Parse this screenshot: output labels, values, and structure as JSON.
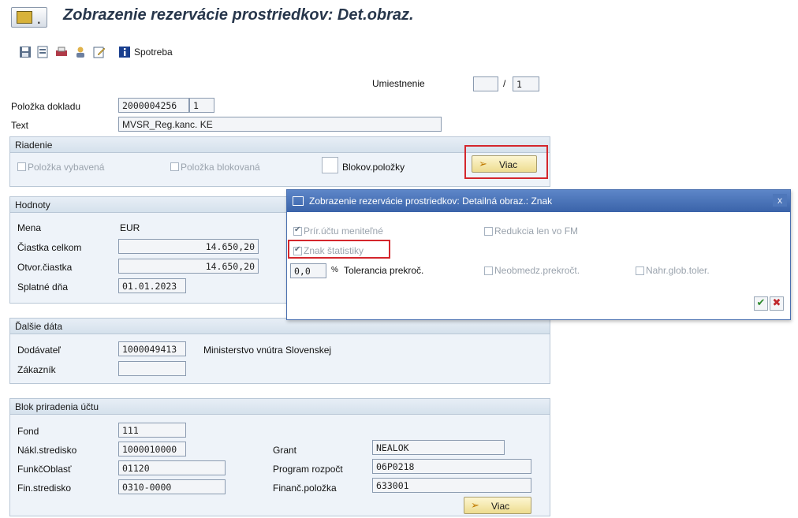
{
  "window": {
    "title": "Zobrazenie rezervácie prostriedkov: Det.obraz."
  },
  "toolbar": {
    "spotreba_label": "Spotreba"
  },
  "header": {
    "umiestnenie_label": "Umiestnenie",
    "umiestnenie_value": "",
    "umiestnenie_sep": "/",
    "umiestnenie_total": "1",
    "polozka_label": "Položka dokladu",
    "polozka_value": "2000004256",
    "polozka_item": "1",
    "text_label": "Text",
    "text_value": "MVSR_Reg.kanc. KE"
  },
  "riadenie": {
    "title": "Riadenie",
    "cb_vybavena": "Položka vybavená",
    "cb_blokovana": "Položka blokovaná",
    "blokov_label": "Blokov.položky",
    "viac_label": "Viac"
  },
  "hodnoty": {
    "title": "Hodnoty",
    "mena_label": "Mena",
    "mena_value": "EUR",
    "celkom_label": "Čiastka celkom",
    "celkom_value": "14.650,20",
    "otvor_label": "Otvor.čiastka",
    "otvor_value": "14.650,20",
    "splatne_label": "Splatné dňa",
    "splatne_value": "01.01.2023"
  },
  "dalsie": {
    "title": "Ďalšie dáta",
    "dodavatel_label": "Dodávateľ",
    "dodavatel_value": "1000049413",
    "dodavatel_name": "Ministerstvo vnútra Slovenskej",
    "zakaznik_label": "Zákazník",
    "zakaznik_value": ""
  },
  "blok": {
    "title": "Blok priradenia účtu",
    "fond_label": "Fond",
    "fond_value": "111",
    "nakl_label": "Nákl.stredisko",
    "nakl_value": "1000010000",
    "funk_label": "FunkčOblasť",
    "funk_value": "01120",
    "fin_label": "Fin.stredisko",
    "fin_value": "0310-0000",
    "grant_label": "Grant",
    "grant_value": "NEALOK",
    "program_label": "Program rozpočt",
    "program_value": "06P0218",
    "financ_label": "Finanč.položka",
    "financ_value": "633001",
    "viac_label": "Viac"
  },
  "popup": {
    "title": "Zobrazenie rezervácie prostriedkov: Detailná obraz.: Znak",
    "close": "x",
    "cb_priructu": "Prír.účtu meniteľné",
    "cb_redukcia": "Redukcia len vo FM",
    "cb_znak": "Znak štatistiky",
    "tolerance_value": "0,0",
    "tolerance_unit": "%",
    "tolerance_label": "Tolerancia prekroč.",
    "cb_neobmedz": "Neobmedz.prekročt.",
    "cb_nahr": "Nahr.glob.toler.",
    "ok": "✔",
    "cancel": "✖"
  },
  "colors": {
    "accent_red": "#d4262c",
    "popup_title": "#3a63a9",
    "group_bg": "#eef3f9"
  }
}
